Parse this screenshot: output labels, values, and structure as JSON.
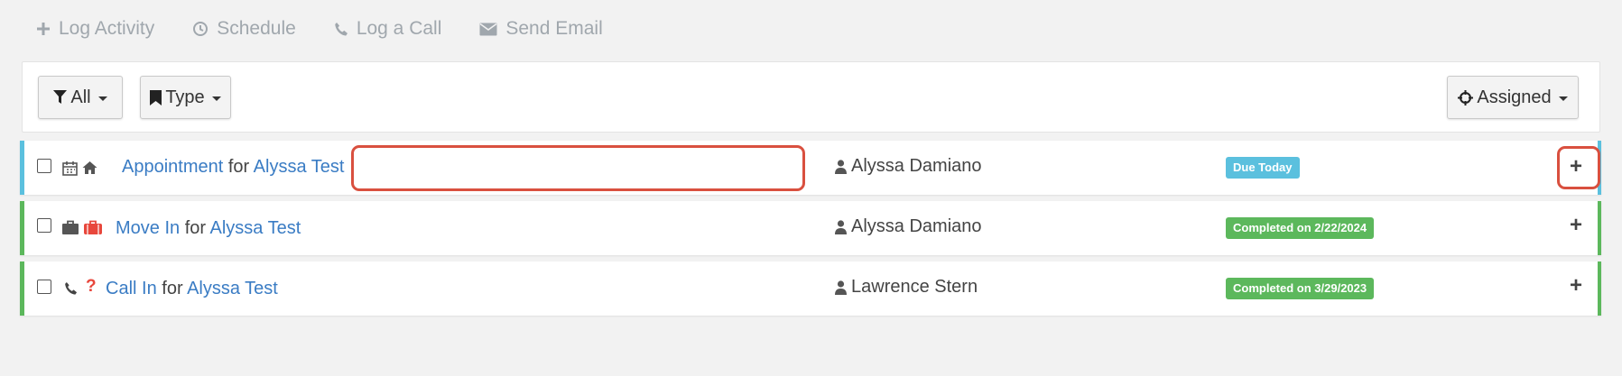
{
  "toolbar": {
    "log_activity": "Log Activity",
    "schedule": "Schedule",
    "log_call": "Log a Call",
    "send_email": "Send Email"
  },
  "filters": {
    "all": "All",
    "type": "Type",
    "assigned": "Assigned"
  },
  "activities": [
    {
      "type_label": "Appointment",
      "connector": "for",
      "contact": "Alyssa Test",
      "assignee": "Alyssa Damiano",
      "status": "Due Today",
      "status_color": "#5bc0de",
      "border_color": "#5bc0de",
      "icons": [
        "calendar-icon",
        "home-icon"
      ]
    },
    {
      "type_label": "Move In",
      "connector": "for",
      "contact": "Alyssa Test",
      "assignee": "Alyssa Damiano",
      "status": "Completed on 2/22/2024",
      "status_color": "#5cb85c",
      "border_color": "#5cb85c",
      "icons": [
        "briefcase-icon",
        "suitcase-icon"
      ]
    },
    {
      "type_label": "Call In",
      "connector": "for",
      "contact": "Alyssa Test",
      "assignee": "Lawrence Stern",
      "status": "Completed on 3/29/2023",
      "status_color": "#5cb85c",
      "border_color": "#5cb85c",
      "icons": [
        "phone-icon",
        "question-icon"
      ]
    }
  ],
  "colors": {
    "link": "#3a7cc4",
    "highlight": "#d9503f",
    "toolbar_text": "#a0a7ad"
  }
}
